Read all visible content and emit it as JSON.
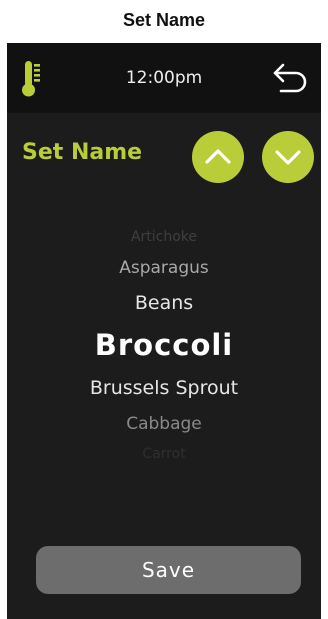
{
  "page": {
    "title": "Set Name"
  },
  "status_bar": {
    "time": "12:00pm",
    "left_icon": "thermometer-icon",
    "right_icon": "back-arrow-icon"
  },
  "screen": {
    "title": "Set Name",
    "up_icon": "chevron-up-icon",
    "down_icon": "chevron-down-icon"
  },
  "name_list": {
    "items": [
      "Artichoke",
      "Asparagus",
      "Beans",
      "Broccoli",
      "Brussels Sprout",
      "Cabbage",
      "Carrot"
    ],
    "selected": "Broccoli"
  },
  "save_button": {
    "label": "Save"
  },
  "colors": {
    "accent": "#b8cd37",
    "screen_bg": "#1c1c1c",
    "status_bg": "#111111",
    "button_bg": "#6d6d6d"
  }
}
